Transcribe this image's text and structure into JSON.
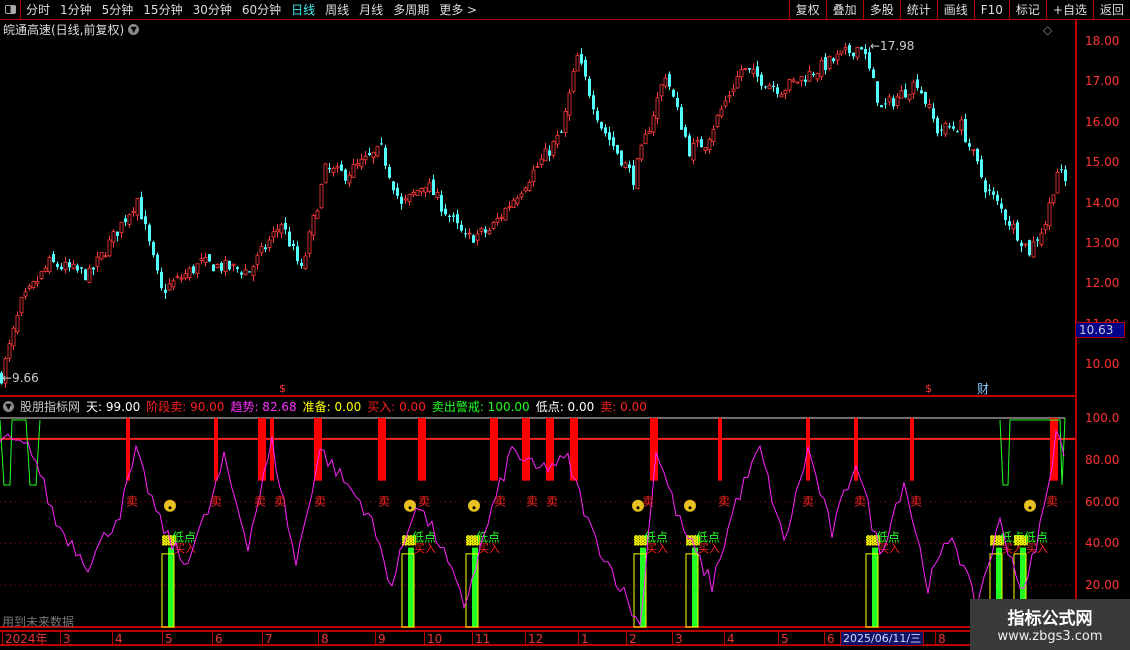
{
  "toolbar": {
    "periods": [
      "分时",
      "1分钟",
      "5分钟",
      "15分钟",
      "30分钟",
      "60分钟",
      "日线",
      "周线",
      "月线",
      "多周期",
      "更多 >"
    ],
    "active": "日线",
    "right_buttons": [
      "复权",
      "叠加",
      "多股",
      "统计",
      "画线",
      "F10",
      "标记",
      "+自选",
      "返回"
    ]
  },
  "title": "皖通高速(日线,前复权)",
  "price_chart": {
    "high_label": "17.98",
    "low_label": "9.66",
    "current_price": "10.63",
    "axis_ticks": [
      "18.00",
      "17.00",
      "16.00",
      "15.00",
      "14.00",
      "13.00",
      "12.00",
      "11.00",
      "10.00"
    ],
    "markers": {
      "dollar": "$",
      "finance": "财"
    },
    "path": [
      [
        0,
        9.7
      ],
      [
        5,
        11.5
      ],
      [
        12,
        12.5
      ],
      [
        22,
        12.2
      ],
      [
        34,
        14.1
      ],
      [
        40,
        11.8
      ],
      [
        50,
        12.5
      ],
      [
        62,
        12.3
      ],
      [
        70,
        13.5
      ],
      [
        75,
        12.3
      ],
      [
        81,
        14.8
      ],
      [
        86,
        14.7
      ],
      [
        95,
        15.3
      ],
      [
        100,
        13.9
      ],
      [
        106,
        14.5
      ],
      [
        116,
        13.1
      ],
      [
        122,
        13.3
      ],
      [
        131,
        14.5
      ],
      [
        140,
        15.7
      ],
      [
        144,
        17.6
      ],
      [
        150,
        15.9
      ],
      [
        158,
        14.6
      ],
      [
        166,
        17.2
      ],
      [
        172,
        15.3
      ],
      [
        176,
        15.5
      ],
      [
        185,
        17.3
      ],
      [
        195,
        16.8
      ],
      [
        204,
        17.3
      ],
      [
        215,
        17.9
      ],
      [
        220,
        16.3
      ],
      [
        229,
        17.0
      ],
      [
        234,
        15.8
      ],
      [
        240,
        15.9
      ],
      [
        246,
        14.4
      ],
      [
        257,
        12.8
      ],
      [
        261,
        13.5
      ],
      [
        264,
        14.8
      ],
      [
        266,
        14.5
      ]
    ],
    "colors": {
      "up": "#ff3b3b",
      "down": "#54ffff"
    }
  },
  "indicator": {
    "name": "股朋指标网",
    "values": [
      {
        "label": "天: 99.00",
        "color": "#ffffff"
      },
      {
        "label": "阶段卖: 90.00",
        "color": "#ff2020"
      },
      {
        "label": "趋势: 82.68",
        "color": "#ff30ff"
      },
      {
        "label": "准备: 0.00",
        "color": "#ffff00"
      },
      {
        "label": "买入: 0.00",
        "color": "#ff2020"
      },
      {
        "label": "卖出警戒: 100.00",
        "color": "#20ff20"
      },
      {
        "label": "低点: 0.00",
        "color": "#ffffff"
      },
      {
        "label": "卖: 0.00",
        "color": "#ff2020"
      }
    ],
    "axis_ticks": [
      "100.0",
      "80.00",
      "60.00",
      "40.00",
      "20.00"
    ],
    "sell_label": "卖",
    "low_label": "低点",
    "buy_label": "买入",
    "sell_bars": [
      32,
      54,
      65,
      68,
      79,
      95,
      105,
      123,
      131,
      137,
      143,
      163,
      180,
      202,
      214,
      228,
      263
    ],
    "sell_marks": [
      33,
      54,
      65,
      70,
      80,
      96,
      106,
      125,
      133,
      138,
      162,
      181,
      202,
      215,
      229,
      263
    ],
    "faces": [
      41,
      101,
      117,
      158,
      171,
      256
    ],
    "low_marks": [
      43,
      103,
      119,
      161,
      174,
      219,
      250,
      256
    ],
    "trend": [
      [
        0,
        90
      ],
      [
        8,
        85
      ],
      [
        14,
        50
      ],
      [
        22,
        30
      ],
      [
        30,
        55
      ],
      [
        34,
        83
      ],
      [
        40,
        50
      ],
      [
        46,
        30
      ],
      [
        52,
        55
      ],
      [
        56,
        80
      ],
      [
        62,
        40
      ],
      [
        68,
        88
      ],
      [
        74,
        30
      ],
      [
        80,
        85
      ],
      [
        86,
        70
      ],
      [
        92,
        55
      ],
      [
        98,
        20
      ],
      [
        104,
        60
      ],
      [
        110,
        40
      ],
      [
        116,
        10
      ],
      [
        122,
        50
      ],
      [
        128,
        85
      ],
      [
        134,
        75
      ],
      [
        142,
        80
      ],
      [
        148,
        45
      ],
      [
        155,
        20
      ],
      [
        160,
        0
      ],
      [
        164,
        85
      ],
      [
        170,
        50
      ],
      [
        178,
        20
      ],
      [
        184,
        60
      ],
      [
        190,
        85
      ],
      [
        196,
        40
      ],
      [
        202,
        85
      ],
      [
        208,
        45
      ],
      [
        214,
        80
      ],
      [
        220,
        35
      ],
      [
        226,
        70
      ],
      [
        232,
        20
      ],
      [
        238,
        45
      ],
      [
        244,
        10
      ],
      [
        250,
        50
      ],
      [
        256,
        15
      ],
      [
        262,
        65
      ],
      [
        264,
        95
      ],
      [
        266,
        82
      ]
    ]
  },
  "time_axis": {
    "labels": [
      "2024年",
      "3",
      "4",
      "5",
      "6",
      "7",
      "8",
      "9",
      "10",
      "11",
      "12",
      "1",
      "2",
      "3",
      "4",
      "5",
      "6",
      "8"
    ],
    "cursor_date": "2025/06/11/三"
  },
  "footer_note": "用到未来数据",
  "watermark": {
    "line1": "指标公式网",
    "line2": "www.zbgs3.com"
  }
}
